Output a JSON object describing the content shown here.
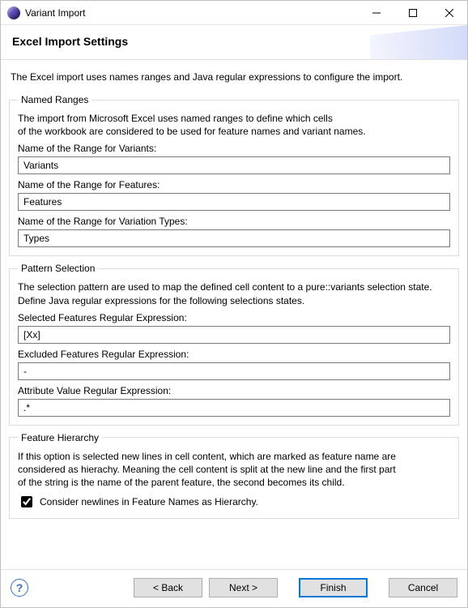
{
  "window": {
    "title": "Variant Import"
  },
  "header": {
    "title": "Excel Import Settings"
  },
  "lead": "The Excel import uses names ranges and Java regular expressions to configure the import.",
  "named_ranges": {
    "legend": "Named Ranges",
    "description_line1": "The import from Microsoft Excel uses named ranges to define which cells",
    "description_line2": "of the workbook are considered to be used for feature names and variant names.",
    "label_variants": "Name of the Range for Variants:",
    "value_variants": "Variants",
    "label_features": "Name of the Range for Features:",
    "value_features": "Features",
    "label_types": "Name of the Range for Variation Types:",
    "value_types": "Types"
  },
  "pattern_selection": {
    "legend": "Pattern Selection",
    "description_line1": "The selection pattern are used to map the defined cell content to a pure::variants selection state.",
    "description_line2": "Define Java regular expressions for the following selections states.",
    "label_selected": "Selected Features Regular Expression:",
    "value_selected": "[Xx]",
    "label_excluded": "Excluded Features Regular Expression:",
    "value_excluded": "-",
    "label_attribute": "Attribute Value Regular Expression:",
    "value_attribute": ".*"
  },
  "feature_hierarchy": {
    "legend": "Feature Hierarchy",
    "description_line1": "If this option is selected new lines in cell content, which are marked as feature name are",
    "description_line2": "considered as hierachy. Meaning the cell content is split at the new line and the first part",
    "description_line3": "of the string is the name of the parent feature, the second becomes its child.",
    "checkbox_label": "Consider newlines in Feature Names as Hierarchy.",
    "checkbox_checked": true
  },
  "footer": {
    "help_glyph": "?",
    "back": "< Back",
    "next": "Next >",
    "finish": "Finish",
    "cancel": "Cancel"
  }
}
